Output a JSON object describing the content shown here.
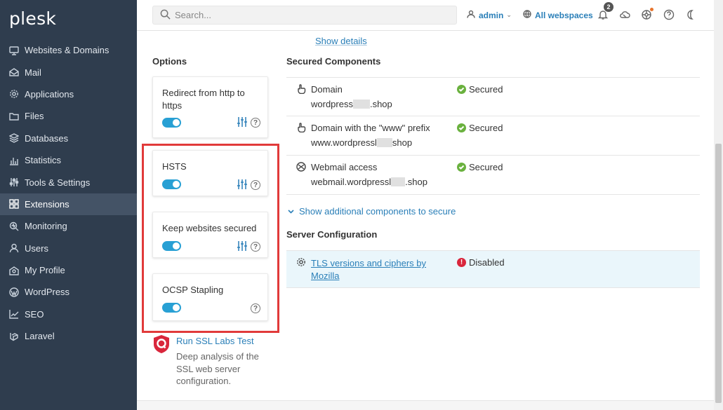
{
  "app": {
    "logo": "plesk"
  },
  "sidebar": {
    "items": [
      {
        "label": "Websites & Domains",
        "icon": "monitor-icon"
      },
      {
        "label": "Mail",
        "icon": "mail-icon"
      },
      {
        "label": "Applications",
        "icon": "gear-icon"
      },
      {
        "label": "Files",
        "icon": "folder-icon"
      },
      {
        "label": "Databases",
        "icon": "database-icon"
      },
      {
        "label": "Statistics",
        "icon": "bar-chart-icon"
      },
      {
        "label": "Tools & Settings",
        "icon": "sliders-icon"
      },
      {
        "label": "Extensions",
        "icon": "extensions-icon",
        "active": true
      },
      {
        "label": "Monitoring",
        "icon": "monitoring-icon"
      },
      {
        "label": "Users",
        "icon": "user-icon"
      },
      {
        "label": "My Profile",
        "icon": "profile-icon"
      },
      {
        "label": "WordPress",
        "icon": "wordpress-icon"
      },
      {
        "label": "SEO",
        "icon": "seo-icon"
      },
      {
        "label": "Laravel",
        "icon": "laravel-icon"
      }
    ]
  },
  "topbar": {
    "search_placeholder": "Search...",
    "user": "admin",
    "webspaces": "All webspaces",
    "notification_count": "2",
    "colors": {
      "accent": "#2a7fb8",
      "sidebar": "#2f3d4e",
      "toggle": "#28a0d4",
      "highlight": "#e13a3a"
    }
  },
  "main": {
    "show_details": "Show details",
    "options_title": "Options",
    "options": [
      {
        "label": "Redirect from http to https",
        "enabled": true,
        "has_settings": true
      },
      {
        "label": "HSTS",
        "enabled": true,
        "has_settings": true
      },
      {
        "label": "Keep websites secured",
        "enabled": true,
        "has_settings": true
      },
      {
        "label": "OCSP Stapling",
        "enabled": true,
        "has_settings": false
      }
    ],
    "ssl_labs": {
      "link": "Run SSL Labs Test",
      "description": "Deep analysis of the SSL web server configuration."
    },
    "secured_title": "Secured Components",
    "components": [
      {
        "name": "Domain",
        "value_start": "wordpress",
        "value_end": ".shop",
        "status": "Secured"
      },
      {
        "name": "Domain with the \"www\" prefix",
        "value_start": "www.wordpressl",
        "value_end": "shop",
        "status": "Secured"
      },
      {
        "name": "Webmail access",
        "value_start": "webmail.wordpressl",
        "value_end": ".shop",
        "status": "Secured"
      }
    ],
    "show_additional": "Show additional components to secure",
    "server_title": "Server Configuration",
    "server_rows": [
      {
        "name": "TLS versions and ciphers by Mozilla",
        "status": "Disabled"
      }
    ]
  }
}
